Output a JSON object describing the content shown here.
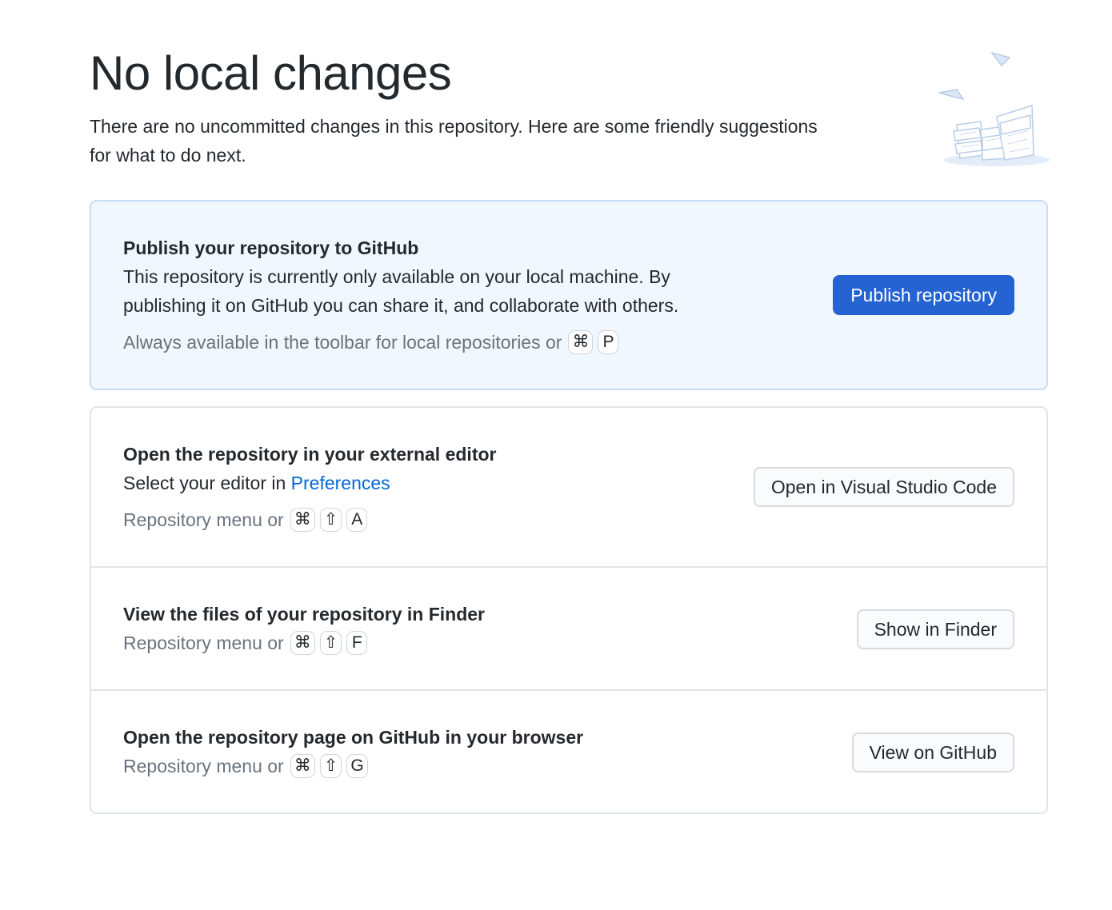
{
  "header": {
    "title": "No local changes",
    "subtitle_line1": "There are no uncommitted changes in this repository. Here are some friendly suggestions",
    "subtitle_line2": "for what to do next."
  },
  "publish": {
    "title": "Publish your repository to GitHub",
    "desc_line1": "This repository is currently only available on your local machine. By",
    "desc_line2": "publishing it on GitHub you can share it, and collaborate with others.",
    "hint": "Always available in the toolbar for local repositories or",
    "keys": [
      "⌘",
      "P"
    ],
    "button_label": "Publish repository"
  },
  "editor": {
    "title": "Open the repository in your external editor",
    "desc_prefix": "Select your editor in",
    "desc_link": "Preferences",
    "hint": "Repository menu or",
    "keys": [
      "⌘",
      "⇧",
      "A"
    ],
    "button_label": "Open in Visual Studio Code"
  },
  "finder": {
    "title": "View the files of your repository in Finder",
    "hint": "Repository menu or",
    "keys": [
      "⌘",
      "⇧",
      "F"
    ],
    "button_label": "Show in Finder"
  },
  "github": {
    "title": "Open the repository page on GitHub in your browser",
    "hint": "Repository menu or",
    "keys": [
      "⌘",
      "⇧",
      "G"
    ],
    "button_label": "View on GitHub"
  },
  "colors": {
    "primary": "#2463d1",
    "link": "#0366d6",
    "muted": "#6a737d",
    "publish_bg": "#f1f7fe"
  }
}
